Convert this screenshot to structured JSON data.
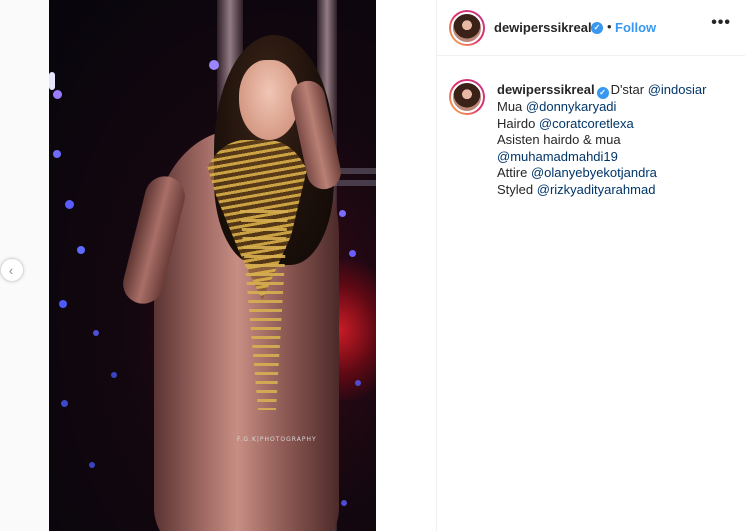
{
  "post": {
    "username": "dewiperssikreal",
    "follow_label": "Follow",
    "separator": "•",
    "more_label": "•••",
    "photo_watermark": "F.G.K|PHOTOGRAPHY"
  },
  "caption": {
    "username": "dewiperssikreal",
    "lines": [
      {
        "text": "D'star ",
        "mention": "@indosiar"
      },
      {
        "text": "Mua ",
        "mention": "@donnykaryadi"
      },
      {
        "text": "Hairdo ",
        "mention": "@coratcoretlexa"
      },
      {
        "text": "Asisten hairdo & mua",
        "mention": ""
      },
      {
        "text": "",
        "mention": "@muhamadmahdi19"
      },
      {
        "text": "Attire ",
        "mention": "@olanyebyekotjandra"
      },
      {
        "text": "Styled ",
        "mention": "@rizkyadityarahmad"
      }
    ]
  },
  "icons": {
    "prev": "chevron-left-icon",
    "verified": "verified-badge-icon",
    "more": "more-options-icon"
  },
  "colors": {
    "link_blue": "#3897f0",
    "mention_blue": "#003569",
    "text": "#262626"
  }
}
